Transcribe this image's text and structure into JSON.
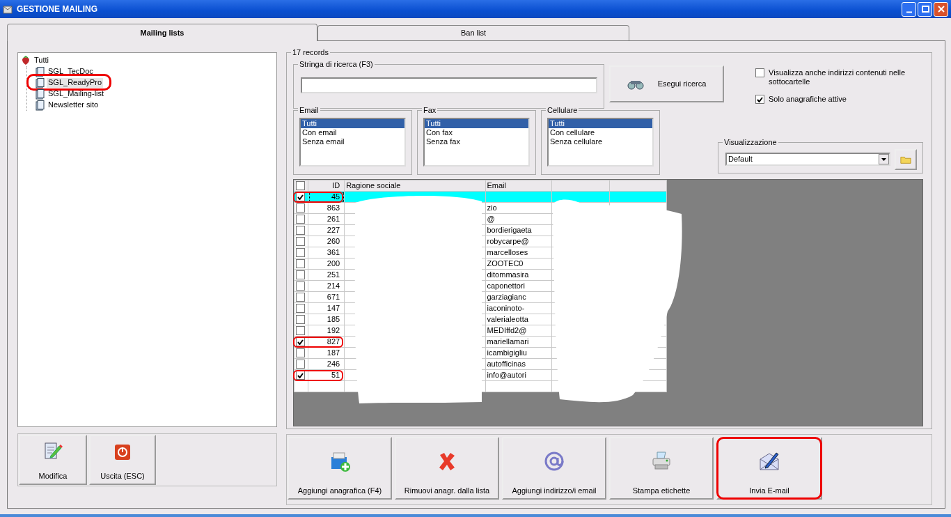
{
  "window": {
    "title": "GESTIONE MAILING"
  },
  "tabs": [
    {
      "label": "Mailing lists",
      "selected": true
    },
    {
      "label": "Ban list",
      "selected": false
    }
  ],
  "tree": {
    "label": "Tutti",
    "children": [
      {
        "label": "SGL_TecDoc",
        "selected": false,
        "marked": false
      },
      {
        "label": "SGL_ReadyPro",
        "selected": true,
        "marked": true
      },
      {
        "label": "SGL_Mailing-list",
        "selected": false,
        "marked": false
      },
      {
        "label": "Newsletter sito",
        "selected": false,
        "marked": false
      }
    ]
  },
  "left_buttons": [
    {
      "label": "Modifica",
      "kind": "edit"
    },
    {
      "label": "Uscita (ESC)",
      "kind": "exit"
    }
  ],
  "records": {
    "title": "17 records",
    "search": {
      "label": "Stringa di ricerca (F3)",
      "button": "Esegui ricerca"
    },
    "options": [
      {
        "label": "Visualizza anche indirizzi contenuti nelle sottocartelle",
        "checked": false
      },
      {
        "label": "Solo anagrafiche attive",
        "checked": true
      }
    ],
    "lists": [
      {
        "title": "Email",
        "items": [
          {
            "label": "Tutti",
            "selected": true
          },
          {
            "label": "Con email",
            "selected": false
          },
          {
            "label": "Senza email",
            "selected": false
          }
        ]
      },
      {
        "title": "Fax",
        "items": [
          {
            "label": "Tutti",
            "selected": true
          },
          {
            "label": "Con fax",
            "selected": false
          },
          {
            "label": "Senza fax",
            "selected": false
          }
        ]
      },
      {
        "title": "Cellulare",
        "items": [
          {
            "label": "Tutti",
            "selected": true
          },
          {
            "label": "Con cellulare",
            "selected": false
          },
          {
            "label": "Senza cellulare",
            "selected": false
          }
        ]
      }
    ],
    "view": {
      "label": "Visualizzazione",
      "value": "Default"
    }
  },
  "grid": {
    "columns": [
      "ID",
      "Ragione sociale",
      "Email"
    ],
    "header_checked": false,
    "rows": [
      {
        "id": "45",
        "checked": true,
        "selected": true,
        "marked": true,
        "email": ""
      },
      {
        "id": "863",
        "checked": false,
        "selected": false,
        "marked": false,
        "email": "zio"
      },
      {
        "id": "261",
        "checked": false,
        "selected": false,
        "marked": false,
        "email": "@"
      },
      {
        "id": "227",
        "checked": false,
        "selected": false,
        "marked": false,
        "email": "bordierigaeta"
      },
      {
        "id": "260",
        "checked": false,
        "selected": false,
        "marked": false,
        "email": "robycarpe@"
      },
      {
        "id": "361",
        "checked": false,
        "selected": false,
        "marked": false,
        "email": "marcelloses"
      },
      {
        "id": "200",
        "checked": false,
        "selected": false,
        "marked": false,
        "email": "ZOOTEC0"
      },
      {
        "id": "251",
        "checked": false,
        "selected": false,
        "marked": false,
        "email": "ditommasira"
      },
      {
        "id": "214",
        "checked": false,
        "selected": false,
        "marked": false,
        "email": "caponettori"
      },
      {
        "id": "671",
        "checked": false,
        "selected": false,
        "marked": false,
        "email": "garziagianc"
      },
      {
        "id": "147",
        "checked": false,
        "selected": false,
        "marked": false,
        "email": "iaconinoto-"
      },
      {
        "id": "185",
        "checked": false,
        "selected": false,
        "marked": false,
        "email": "valerialeotta"
      },
      {
        "id": "192",
        "checked": false,
        "selected": false,
        "marked": false,
        "email": "MEDIffd2@"
      },
      {
        "id": "827",
        "checked": true,
        "selected": false,
        "marked": true,
        "email": "mariellamari"
      },
      {
        "id": "187",
        "checked": false,
        "selected": false,
        "marked": false,
        "email": "icambigigliu"
      },
      {
        "id": "246",
        "checked": false,
        "selected": false,
        "marked": false,
        "email": "autofficinas"
      },
      {
        "id": "51",
        "checked": true,
        "selected": false,
        "marked": true,
        "email": "info@autori"
      }
    ]
  },
  "actions": [
    {
      "label": "Aggiungi anagrafica (F4)",
      "kind": "add",
      "marked": false
    },
    {
      "label": "Rimuovi anagr. dalla lista",
      "kind": "remove",
      "marked": false
    },
    {
      "label": "Aggiungi indirizzo/i email",
      "kind": "at",
      "marked": false
    },
    {
      "label": "Stampa etichette",
      "kind": "print",
      "marked": false
    },
    {
      "label": "Invia E-mail",
      "kind": "send",
      "marked": true
    }
  ]
}
